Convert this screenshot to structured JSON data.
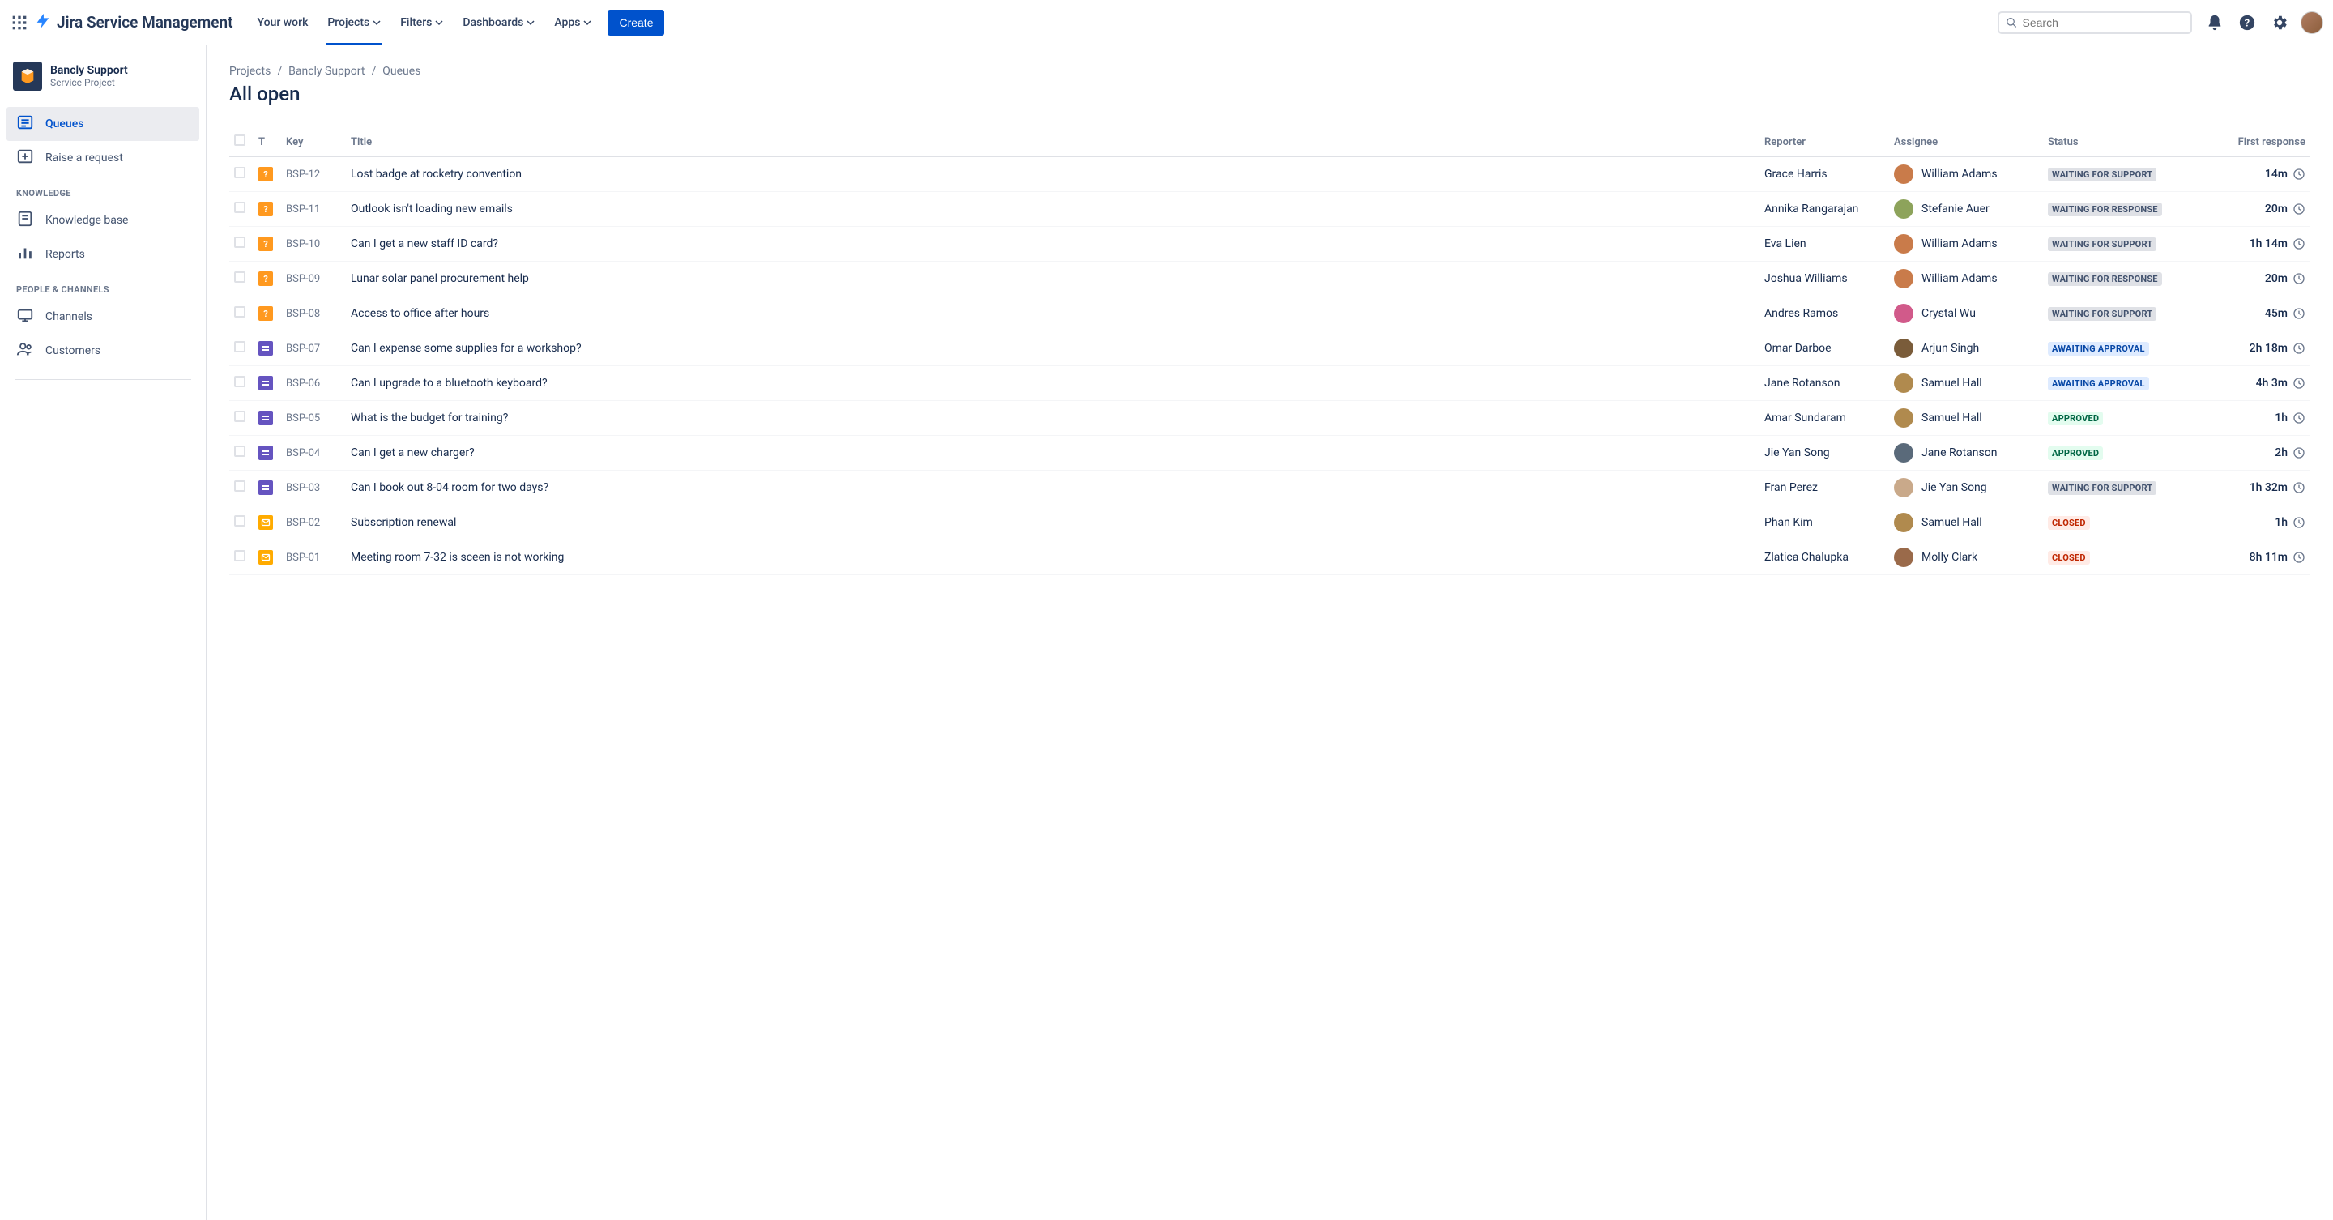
{
  "header": {
    "product": "Jira Service Management",
    "nav": [
      "Your work",
      "Projects",
      "Filters",
      "Dashboards",
      "Apps"
    ],
    "create": "Create",
    "search_placeholder": "Search"
  },
  "sidebar": {
    "project_name": "Bancly Support",
    "project_type": "Service Project",
    "items_top": [
      {
        "label": "Queues",
        "icon": "queue",
        "active": true
      },
      {
        "label": "Raise a request",
        "icon": "raise"
      }
    ],
    "section_knowledge": "KNOWLEDGE",
    "items_knowledge": [
      {
        "label": "Knowledge base",
        "icon": "kb"
      },
      {
        "label": "Reports",
        "icon": "reports"
      }
    ],
    "section_people": "PEOPLE & CHANNELS",
    "items_people": [
      {
        "label": "Channels",
        "icon": "channels"
      },
      {
        "label": "Customers",
        "icon": "customers"
      }
    ]
  },
  "breadcrumb": [
    "Projects",
    "Bancly Support",
    "Queues"
  ],
  "page_title": "All open",
  "columns": {
    "t": "T",
    "key": "Key",
    "title": "Title",
    "reporter": "Reporter",
    "assignee": "Assignee",
    "status": "Status",
    "first": "First response"
  },
  "avatar_colors": {
    "William Adams": "#c97b4a",
    "Stefanie Auer": "#8da35b",
    "Crystal Wu": "#d15a8a",
    "Arjun Singh": "#7a5c3a",
    "Samuel Hall": "#b08a4e",
    "Jane Rotanson": "#5a6a7a",
    "Jie Yan Song": "#c9a98a",
    "Molly Clark": "#9a6a4a"
  },
  "rows": [
    {
      "type": "orange",
      "key": "BSP-12",
      "title": "Lost badge at rocketry convention",
      "reporter": "Grace Harris",
      "assignee": "William Adams",
      "status": "WAITING FOR SUPPORT",
      "status_class": "loz-gray",
      "first": "14m"
    },
    {
      "type": "orange",
      "key": "BSP-11",
      "title": "Outlook isn't loading new emails",
      "reporter": "Annika Rangarajan",
      "assignee": "Stefanie Auer",
      "status": "WAITING FOR RESPONSE",
      "status_class": "loz-gray",
      "first": "20m"
    },
    {
      "type": "orange",
      "key": "BSP-10",
      "title": "Can I get a new staff ID card?",
      "reporter": "Eva Lien",
      "assignee": "William Adams",
      "status": "WAITING FOR SUPPORT",
      "status_class": "loz-gray",
      "first": "1h 14m"
    },
    {
      "type": "orange",
      "key": "BSP-09",
      "title": "Lunar solar panel procurement help",
      "reporter": "Joshua Williams",
      "assignee": "William Adams",
      "status": "WAITING FOR RESPONSE",
      "status_class": "loz-gray",
      "first": "20m"
    },
    {
      "type": "orange",
      "key": "BSP-08",
      "title": "Access to office after hours",
      "reporter": "Andres Ramos",
      "assignee": "Crystal Wu",
      "status": "WAITING FOR SUPPORT",
      "status_class": "loz-gray",
      "first": "45m"
    },
    {
      "type": "purple",
      "key": "BSP-07",
      "title": "Can I expense some supplies for a workshop?",
      "reporter": "Omar Darboe",
      "assignee": "Arjun Singh",
      "status": "AWAITING APPROVAL",
      "status_class": "loz-blue",
      "first": "2h 18m"
    },
    {
      "type": "purple",
      "key": "BSP-06",
      "title": "Can I upgrade to a bluetooth keyboard?",
      "reporter": "Jane Rotanson",
      "assignee": "Samuel Hall",
      "status": "AWAITING APPROVAL",
      "status_class": "loz-blue",
      "first": "4h 3m"
    },
    {
      "type": "purple",
      "key": "BSP-05",
      "title": "What is the budget for training?",
      "reporter": "Amar Sundaram",
      "assignee": "Samuel Hall",
      "status": "APPROVED",
      "status_class": "loz-green",
      "first": "1h"
    },
    {
      "type": "purple",
      "key": "BSP-04",
      "title": "Can I get a new charger?",
      "reporter": "Jie Yan Song",
      "assignee": "Jane Rotanson",
      "status": "APPROVED",
      "status_class": "loz-green",
      "first": "2h"
    },
    {
      "type": "purple",
      "key": "BSP-03",
      "title": "Can I book out 8-04 room for two days?",
      "reporter": "Fran Perez",
      "assignee": "Jie Yan Song",
      "status": "WAITING FOR SUPPORT",
      "status_class": "loz-gray",
      "first": "1h 32m"
    },
    {
      "type": "yellow",
      "key": "BSP-02",
      "title": "Subscription renewal",
      "reporter": "Phan Kim",
      "assignee": "Samuel Hall",
      "status": "CLOSED",
      "status_class": "loz-red",
      "first": "1h"
    },
    {
      "type": "yellow",
      "key": "BSP-01",
      "title": "Meeting room 7-32 is sceen is not working",
      "reporter": "Zlatica Chalupka",
      "assignee": "Molly Clark",
      "status": "CLOSED",
      "status_class": "loz-red",
      "first": "8h 11m"
    }
  ]
}
